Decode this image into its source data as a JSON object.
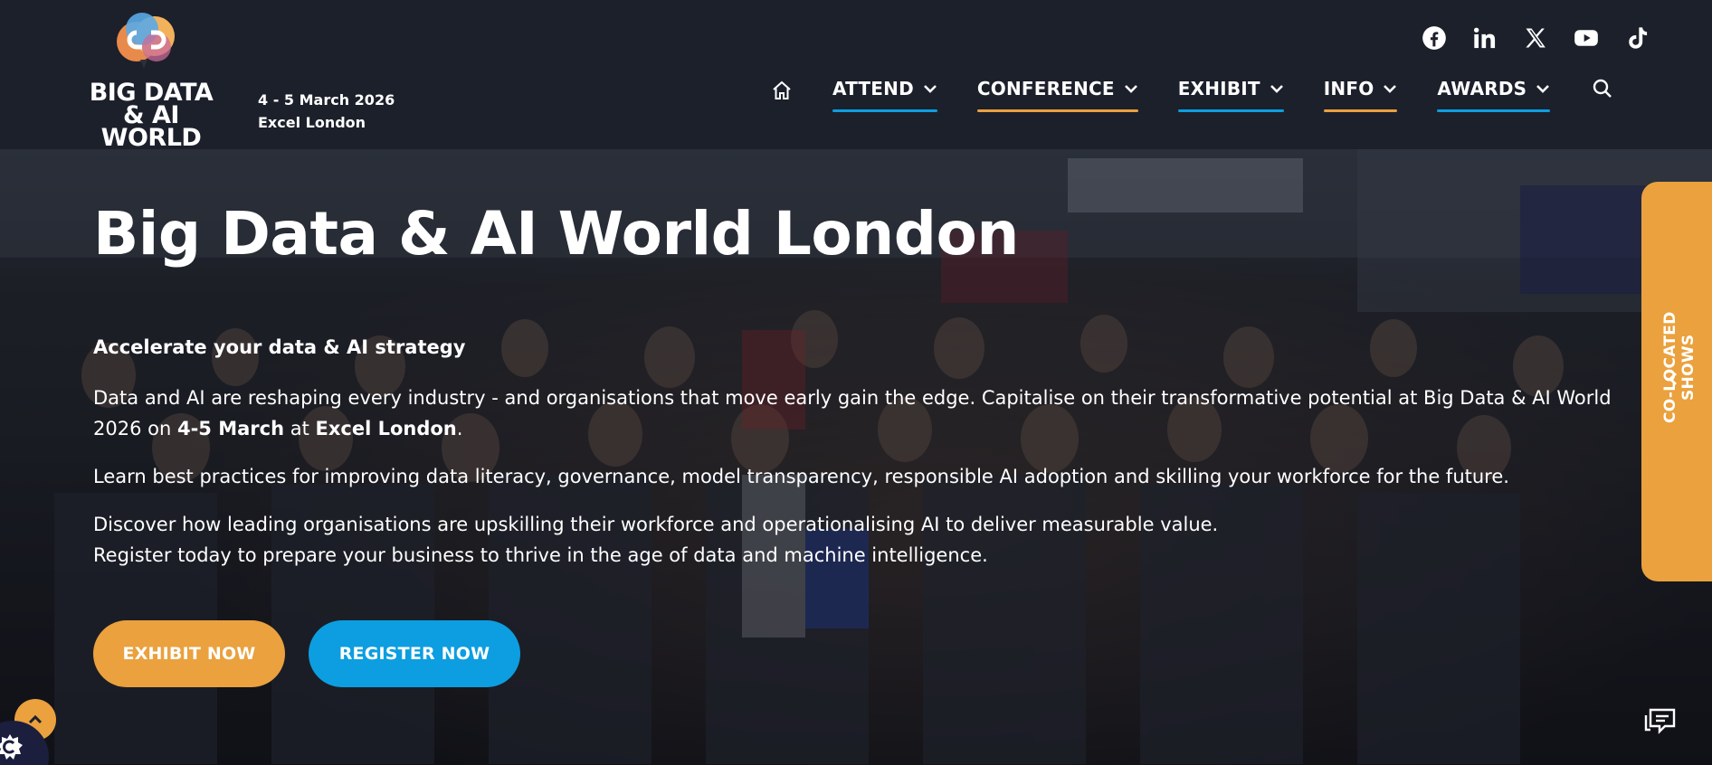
{
  "brand": {
    "logo_text_line1": "BIG DATA",
    "logo_text_line2": "& AI WORLD",
    "event_dates": "4 - 5 March 2026",
    "venue": "Excel London"
  },
  "social": [
    "facebook-icon",
    "linkedin-icon",
    "x-icon",
    "youtube-icon",
    "tiktok-icon"
  ],
  "nav": {
    "items": [
      {
        "label": "ATTEND",
        "underline": "#0c9ee0"
      },
      {
        "label": "CONFERENCE",
        "underline": "#eaa13e"
      },
      {
        "label": "EXHIBIT",
        "underline": "#0c9ee0"
      },
      {
        "label": "INFO",
        "underline": "#eaa13e"
      },
      {
        "label": "AWARDS",
        "underline": "#0c9ee0"
      }
    ]
  },
  "hero": {
    "title": "Big Data & AI World London",
    "subtitle": "Accelerate your data & AI strategy",
    "p1_start": "Data and AI are reshaping every industry - and organisations that move early gain the edge. Capitalise on their transformative potential at Big Data & AI World 2026 on ",
    "p1_dates": "4-5 March",
    "p1_mid": " at ",
    "p1_venue": "Excel London",
    "p1_end": ".",
    "p2": "Learn best practices for improving data literacy, governance, model transparency, responsible AI adoption and skilling your workforce for the future.",
    "p3_line1": "Discover how leading organisations are upskilling their workforce and operationalising AI to deliver measurable value.",
    "p3_line2": "Register today to prepare your business to thrive in the age of data and machine intelligence.",
    "exhibit_btn": "EXHIBIT NOW",
    "register_btn": "REGISTER NOW"
  },
  "side_tab": {
    "label": "CO-LOCATED SHOWS"
  },
  "colors": {
    "orange": "#eaa13e",
    "blue": "#0c9ee0",
    "header_bg": "#1c202b"
  }
}
